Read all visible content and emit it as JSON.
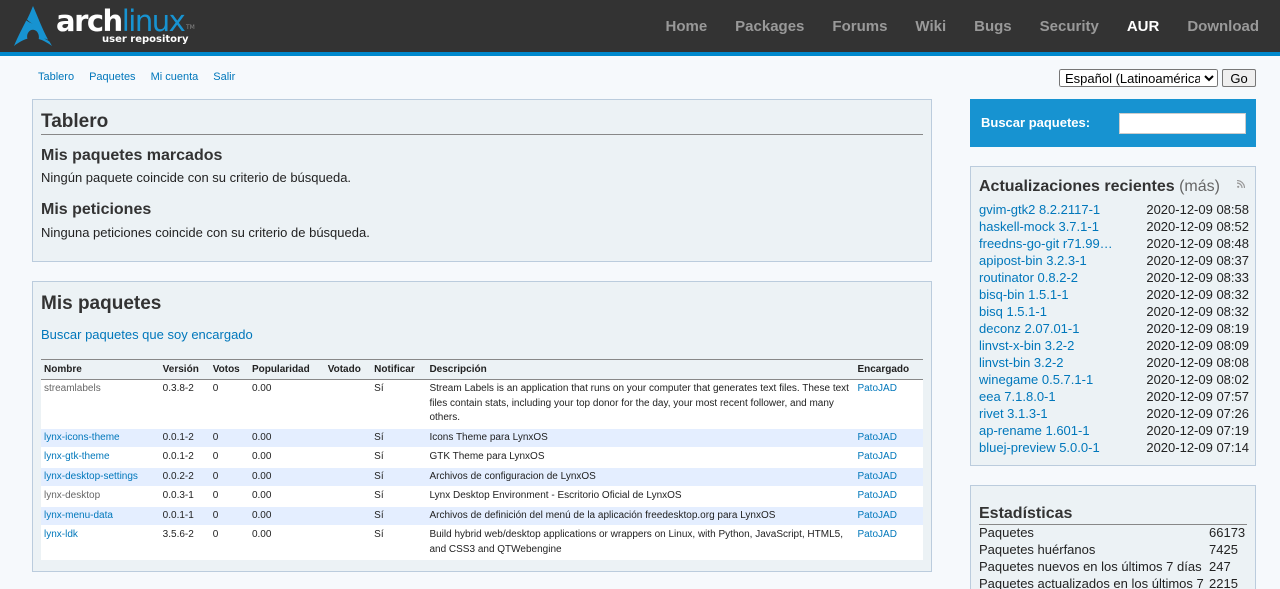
{
  "header": {
    "brand_main": "arch",
    "brand_accent": "linux",
    "brand_tm": "TM",
    "brand_sub": "user repository",
    "nav": [
      {
        "label": "Home"
      },
      {
        "label": "Packages"
      },
      {
        "label": "Forums"
      },
      {
        "label": "Wiki"
      },
      {
        "label": "Bugs"
      },
      {
        "label": "Security"
      },
      {
        "label": "AUR",
        "active": true
      },
      {
        "label": "Download"
      }
    ]
  },
  "subnav": [
    "Tablero",
    "Paquetes",
    "Mi cuenta",
    "Salir"
  ],
  "language": {
    "selected": "Español (Latinoamérica)",
    "go_label": "Go"
  },
  "dashboard": {
    "title": "Tablero",
    "flagged_title": "Mis paquetes marcados",
    "flagged_empty": "Ningún paquete coincide con su criterio de búsqueda.",
    "requests_title": "Mis peticiones",
    "requests_empty": "Ninguna peticiones coincide con su criterio de búsqueda."
  },
  "my_packages": {
    "title": "Mis paquetes",
    "maintained_link": "Buscar paquetes que soy encargado",
    "columns": [
      "Nombre",
      "Versión",
      "Votos",
      "Popularidad",
      "Votado",
      "Notificar",
      "Descripción",
      "Encargado"
    ],
    "rows": [
      {
        "name": "streamlabels",
        "orphan": true,
        "version": "0.3.8-2",
        "votes": "0",
        "popularity": "0.00",
        "voted": "",
        "notify": "Sí",
        "description": "Stream Labels is an application that runs on your computer that generates text files. These text files contain stats, including your top donor for the day, your most recent follower, and many others.",
        "maintainer": "PatoJAD"
      },
      {
        "name": "lynx-icons-theme",
        "orphan": false,
        "version": "0.0.1-2",
        "votes": "0",
        "popularity": "0.00",
        "voted": "",
        "notify": "Sí",
        "description": "Icons Theme para LynxOS",
        "maintainer": "PatoJAD"
      },
      {
        "name": "lynx-gtk-theme",
        "orphan": false,
        "version": "0.0.1-2",
        "votes": "0",
        "popularity": "0.00",
        "voted": "",
        "notify": "Sí",
        "description": "GTK Theme para LynxOS",
        "maintainer": "PatoJAD"
      },
      {
        "name": "lynx-desktop-settings",
        "orphan": false,
        "version": "0.0.2-2",
        "votes": "0",
        "popularity": "0.00",
        "voted": "",
        "notify": "Sí",
        "description": "Archivos de configuracion de LynxOS",
        "maintainer": "PatoJAD"
      },
      {
        "name": "lynx-desktop",
        "orphan": true,
        "version": "0.0.3-1",
        "votes": "0",
        "popularity": "0.00",
        "voted": "",
        "notify": "Sí",
        "description": "Lynx Desktop Environment - Escritorio Oficial de LynxOS",
        "maintainer": "PatoJAD"
      },
      {
        "name": "lynx-menu-data",
        "orphan": false,
        "version": "0.0.1-1",
        "votes": "0",
        "popularity": "0.00",
        "voted": "",
        "notify": "Sí",
        "description": "Archivos de definición del menú de la aplicación freedesktop.org para LynxOS",
        "maintainer": "PatoJAD"
      },
      {
        "name": "lynx-ldk",
        "orphan": false,
        "version": "3.5.6-2",
        "votes": "0",
        "popularity": "0.00",
        "voted": "",
        "notify": "Sí",
        "description": "Build hybrid web/desktop applications or wrappers on Linux, with Python, JavaScript, HTML5, and CSS3 and QTWebengine",
        "maintainer": "PatoJAD"
      }
    ]
  },
  "search": {
    "label": "Buscar paquetes:",
    "value": ""
  },
  "recent_updates": {
    "title": "Actualizaciones recientes",
    "more": "(más)",
    "items": [
      {
        "pkg": "gvim-gtk2 8.2.2117-1",
        "date": "2020-12-09 08:58"
      },
      {
        "pkg": "haskell-mock 3.7.1-1",
        "date": "2020-12-09 08:52"
      },
      {
        "pkg": "freedns-go-git r71.99…",
        "date": "2020-12-09 08:48"
      },
      {
        "pkg": "apipost-bin 3.2.3-1",
        "date": "2020-12-09 08:37"
      },
      {
        "pkg": "routinator 0.8.2-2",
        "date": "2020-12-09 08:33"
      },
      {
        "pkg": "bisq-bin 1.5.1-1",
        "date": "2020-12-09 08:32"
      },
      {
        "pkg": "bisq 1.5.1-1",
        "date": "2020-12-09 08:32"
      },
      {
        "pkg": "deconz 2.07.01-1",
        "date": "2020-12-09 08:19"
      },
      {
        "pkg": "linvst-x-bin 3.2-2",
        "date": "2020-12-09 08:09"
      },
      {
        "pkg": "linvst-bin 3.2-2",
        "date": "2020-12-09 08:08"
      },
      {
        "pkg": "winegame 0.5.7.1-1",
        "date": "2020-12-09 08:02"
      },
      {
        "pkg": "eea 7.1.8.0-1",
        "date": "2020-12-09 07:57"
      },
      {
        "pkg": "rivet 3.1.3-1",
        "date": "2020-12-09 07:26"
      },
      {
        "pkg": "ap-rename 1.601-1",
        "date": "2020-12-09 07:19"
      },
      {
        "pkg": "bluej-preview 5.0.0-1",
        "date": "2020-12-09 07:14"
      }
    ]
  },
  "statistics": {
    "title": "Estadísticas",
    "rows": [
      {
        "label": "Paquetes",
        "value": "66173"
      },
      {
        "label": "Paquetes huérfanos",
        "value": "7425"
      },
      {
        "label": "Paquetes nuevos en los últimos 7 días",
        "value": "247"
      },
      {
        "label": "Paquetes actualizados en los últimos 7",
        "value": "2215"
      }
    ]
  },
  "colors": {
    "topbar": "#333333",
    "accent": "#1793d1",
    "link": "#0077bb",
    "panel": "#ecf2f5"
  },
  "icons": {
    "logo": "arch-logo-icon",
    "rss": "rss-feed-icon"
  }
}
